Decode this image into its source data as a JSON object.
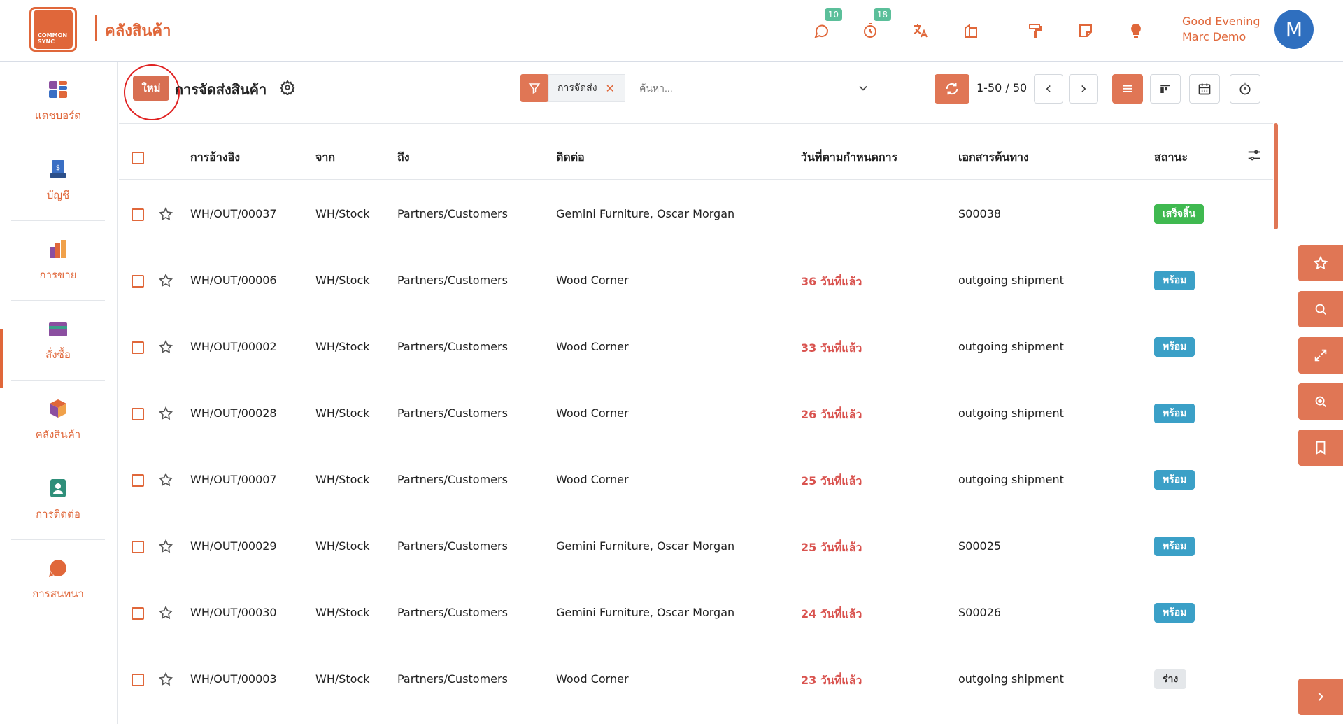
{
  "app": {
    "logo_text": "COMMON SYNC",
    "module_title": "คลังสินค้า",
    "greeting_line1": "Good Evening",
    "greeting_line2": "Marc Demo",
    "avatar_letter": "M",
    "messages_badge": "10",
    "activities_badge": "18"
  },
  "sidebar": {
    "items": [
      {
        "label": "แดชบอร์ด",
        "icon": "dashboard-icon"
      },
      {
        "label": "บัญชี",
        "icon": "accounting-icon"
      },
      {
        "label": "การขาย",
        "icon": "sales-icon"
      },
      {
        "label": "สั่งซื้อ",
        "icon": "purchase-icon"
      },
      {
        "label": "คลังสินค้า",
        "icon": "inventory-icon"
      },
      {
        "label": "การติดต่อ",
        "icon": "contacts-icon"
      },
      {
        "label": "การสนทนา",
        "icon": "discuss-icon"
      }
    ]
  },
  "control_panel": {
    "new_label": "ใหม่",
    "page_title": "การจัดส่งสินค้า",
    "facet_label": "การจัดส่ง",
    "search_placeholder": "ค้นหา...",
    "pager": "1-50 / 50"
  },
  "table": {
    "headers": {
      "reference": "การอ้างอิง",
      "from": "จาก",
      "to": "ถึง",
      "contact": "ติดต่อ",
      "scheduled": "วันที่ตามกำหนดการ",
      "source": "เอกสารต้นทาง",
      "status": "สถานะ"
    },
    "rows": [
      {
        "ref": "WH/OUT/00037",
        "from": "WH/Stock",
        "to": "Partners/Customers",
        "contact": "Gemini Furniture, Oscar Morgan",
        "scheduled": "",
        "source": "S00038",
        "status": "เสร็จสิ้น",
        "status_kind": "done"
      },
      {
        "ref": "WH/OUT/00006",
        "from": "WH/Stock",
        "to": "Partners/Customers",
        "contact": "Wood Corner",
        "scheduled": "36 วันที่แล้ว",
        "source": "outgoing shipment",
        "status": "พร้อม",
        "status_kind": "ready"
      },
      {
        "ref": "WH/OUT/00002",
        "from": "WH/Stock",
        "to": "Partners/Customers",
        "contact": "Wood Corner",
        "scheduled": "33 วันที่แล้ว",
        "source": "outgoing shipment",
        "status": "พร้อม",
        "status_kind": "ready"
      },
      {
        "ref": "WH/OUT/00028",
        "from": "WH/Stock",
        "to": "Partners/Customers",
        "contact": "Wood Corner",
        "scheduled": "26 วันที่แล้ว",
        "source": "outgoing shipment",
        "status": "พร้อม",
        "status_kind": "ready"
      },
      {
        "ref": "WH/OUT/00007",
        "from": "WH/Stock",
        "to": "Partners/Customers",
        "contact": "Wood Corner",
        "scheduled": "25 วันที่แล้ว",
        "source": "outgoing shipment",
        "status": "พร้อม",
        "status_kind": "ready"
      },
      {
        "ref": "WH/OUT/00029",
        "from": "WH/Stock",
        "to": "Partners/Customers",
        "contact": "Gemini Furniture, Oscar Morgan",
        "scheduled": "25 วันที่แล้ว",
        "source": "S00025",
        "status": "พร้อม",
        "status_kind": "ready"
      },
      {
        "ref": "WH/OUT/00030",
        "from": "WH/Stock",
        "to": "Partners/Customers",
        "contact": "Gemini Furniture, Oscar Morgan",
        "scheduled": "24 วันที่แล้ว",
        "source": "S00026",
        "status": "พร้อม",
        "status_kind": "ready"
      },
      {
        "ref": "WH/OUT/00003",
        "from": "WH/Stock",
        "to": "Partners/Customers",
        "contact": "Wood Corner",
        "scheduled": "23 วันที่แล้ว",
        "source": "outgoing shipment",
        "status": "ร่าง",
        "status_kind": "draft"
      }
    ]
  },
  "colors": {
    "accent": "#e0673a",
    "button": "#e07655",
    "late": "#d9534f",
    "done": "#3fb950",
    "ready": "#3ba0c7"
  }
}
